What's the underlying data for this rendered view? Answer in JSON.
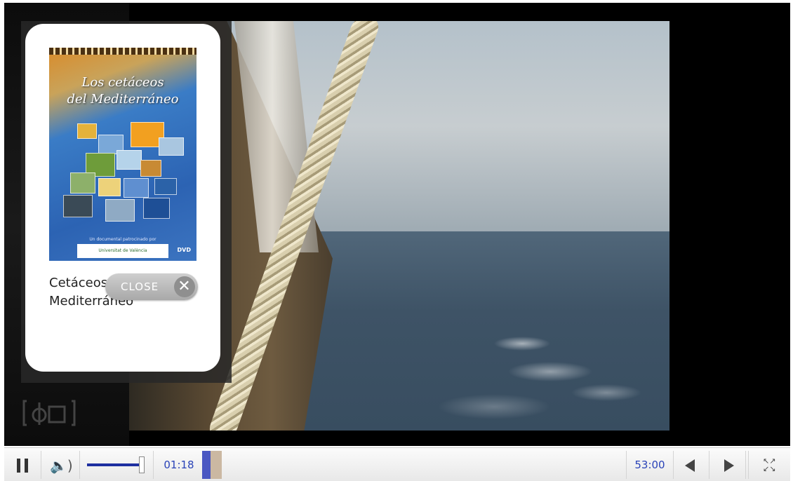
{
  "popup": {
    "cover_title_line1": "Los cetáceos",
    "cover_title_line2": "del Mediterráneo",
    "cover_caption": "Un documental patrocinado por",
    "cover_logo_text": "Universitat de València",
    "cover_dvd_label": "DVD",
    "title": "Cetáceos del Mediterráneo",
    "close_label": "CLOSE",
    "close_icon": "close-icon"
  },
  "player": {
    "time_current": "01:18",
    "time_total": "53:00",
    "progress_played": 0.024,
    "volume_level": 0.85,
    "state": "playing",
    "accent_color": "#2a43b8"
  },
  "icons": {
    "pause": "pause-icon",
    "volume": "volume-icon",
    "prev": "prev-icon",
    "next": "next-icon",
    "fullscreen": "fullscreen-icon",
    "watermark": "brand-logo-icon"
  }
}
